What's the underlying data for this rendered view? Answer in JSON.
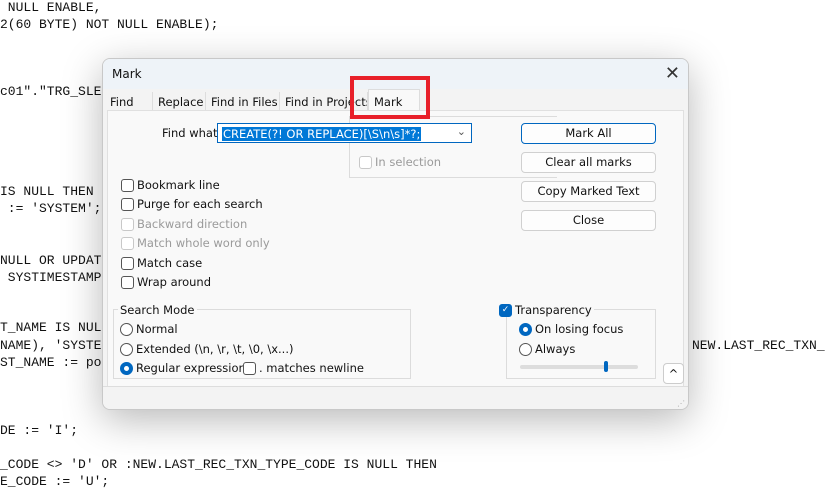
{
  "editor": {
    "lines": [
      " NULL ENABLE,",
      "2(60 BYTE) NOT NULL ENABLE);",
      "c01\".\"TRG_SLE",
      "IS NULL THEN",
      " := 'SYSTEM';",
      "NULL OR UPDAT",
      " SYSTIMESTAMP",
      "T_NAME IS NUL",
      "NAME), 'SYSTE",
      "ST_NAME := po",
      "DE := 'I';",
      "_CODE <> 'D' OR :NEW.LAST_REC_TXN_TYPE_CODE IS NULL THEN",
      "E_CODE := 'U';"
    ],
    "right_fragment": "NEW.LAST_REC_TXN_"
  },
  "dialog": {
    "title": "Mark",
    "close_icon": "close-icon",
    "tabs": [
      {
        "label": "Find"
      },
      {
        "label": "Replace"
      },
      {
        "label": "Find in Files"
      },
      {
        "label": "Find in Projects"
      },
      {
        "label": "Mark",
        "active": true
      }
    ],
    "find_what_label": "Find what:",
    "find_what_value": "CREATE(?! OR REPLACE)[\\S\\n\\s]*?;",
    "in_selection": "In selection",
    "buttons": {
      "mark_all": "Mark All",
      "clear": "Clear all marks",
      "copy": "Copy Marked Text",
      "close": "Close"
    },
    "options": [
      {
        "label": "Bookmark line",
        "checked": false,
        "enabled": true
      },
      {
        "label": "Purge for each search",
        "checked": false,
        "enabled": true
      },
      {
        "label": "Backward direction",
        "checked": false,
        "enabled": false
      },
      {
        "label": "Match whole word only",
        "checked": false,
        "enabled": false
      },
      {
        "label": "Match case",
        "checked": false,
        "enabled": true
      },
      {
        "label": "Wrap around",
        "checked": false,
        "enabled": true
      }
    ],
    "search_mode": {
      "title": "Search Mode",
      "normal": "Normal",
      "extended": "Extended (\\n, \\r, \\t, \\0, \\x...)",
      "regex": "Regular expression",
      "selected": "Regular expression",
      "dot_newline": ". matches newline"
    },
    "transparency": {
      "label": "Transparency",
      "checked": true,
      "on_losing_focus": "On losing focus",
      "always": "Always",
      "selected": "On losing focus",
      "slider_percent": 71
    },
    "collapse_label": "^",
    "highlight_color": "#e8202a",
    "accent": "#0067c0"
  }
}
